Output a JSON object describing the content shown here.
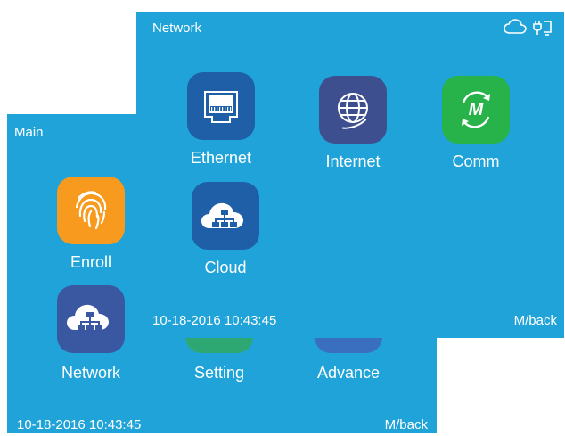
{
  "main": {
    "title": "Main",
    "items": [
      {
        "label": "Enroll",
        "icon": "fingerprint-icon",
        "color": "#f79a1e"
      },
      {
        "label": "Network",
        "icon": "cloud-network-icon",
        "color": "#3a57a2"
      },
      {
        "label": "Setting",
        "icon": "gear-icon",
        "color": "#2ea872"
      },
      {
        "label": "Advance",
        "icon": "advance-icon",
        "color": "#3a6fc0"
      }
    ],
    "datetime": "10-18-2016 10:43:45",
    "back": "M/back"
  },
  "network": {
    "title": "Network",
    "status_icons": [
      "cloud-icon",
      "plug-icon"
    ],
    "items": [
      {
        "label": "Ethernet",
        "icon": "ethernet-port-icon",
        "color": "#1e5fa8"
      },
      {
        "label": "Internet",
        "icon": "globe-icon",
        "color": "#3e4f8f"
      },
      {
        "label": "Comm",
        "icon": "comm-m-icon",
        "color": "#27b34a"
      },
      {
        "label": "Cloud",
        "icon": "cloud-network-icon",
        "color": "#1e5fa8"
      }
    ],
    "datetime": "10-18-2016 10:43:45",
    "back": "M/back"
  }
}
